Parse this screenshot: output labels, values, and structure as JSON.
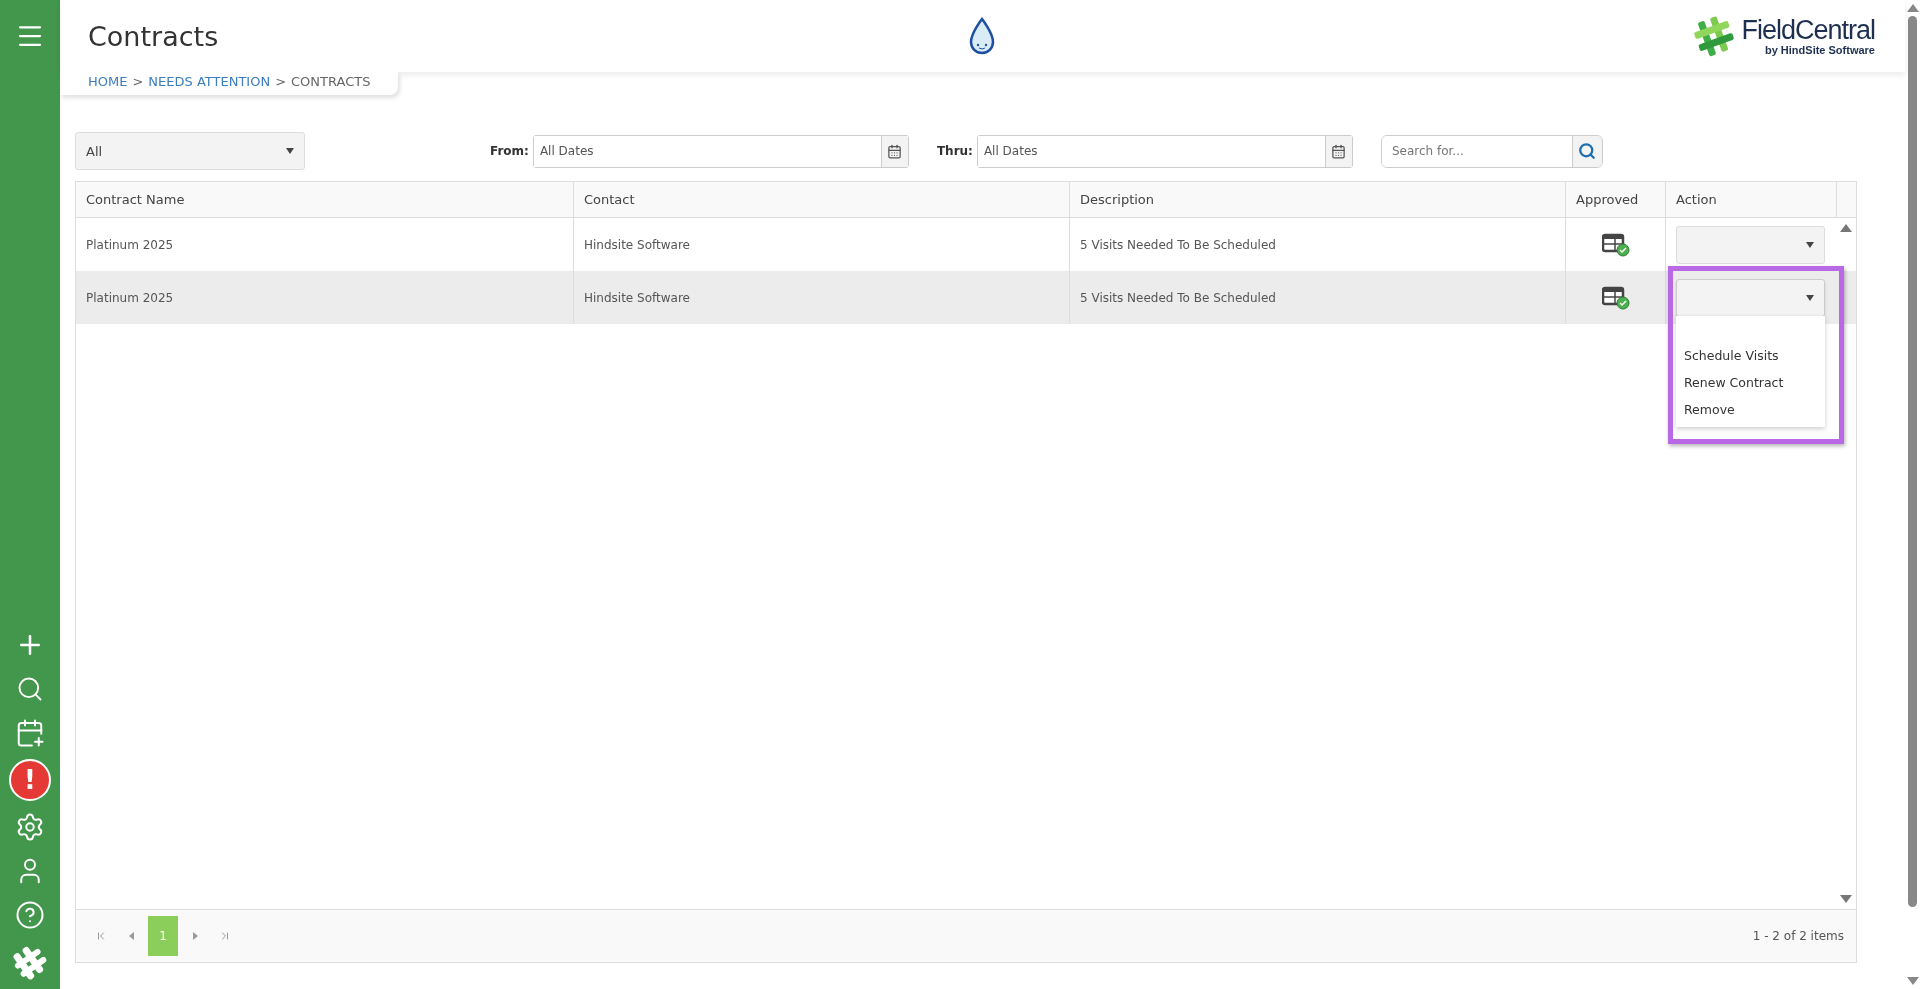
{
  "page": {
    "title": "Contracts"
  },
  "breadcrumb": [
    {
      "label": "HOME",
      "link": true
    },
    {
      "label": ">",
      "link": false
    },
    {
      "label": "NEEDS ATTENTION",
      "link": true
    },
    {
      "label": ">",
      "link": false
    },
    {
      "label": "CONTRACTS",
      "link": false
    }
  ],
  "brand": {
    "name": "FieldCentral",
    "tagline": "by HindSite Software"
  },
  "sidebar": {
    "items": [
      {
        "kind": "add",
        "alert": false
      },
      {
        "kind": "search",
        "alert": false
      },
      {
        "kind": "schedule",
        "alert": false
      },
      {
        "kind": "alert",
        "alert": true,
        "glyph": "!"
      },
      {
        "kind": "settings",
        "alert": false
      },
      {
        "kind": "user",
        "alert": false
      },
      {
        "kind": "help",
        "alert": false
      }
    ]
  },
  "filters": {
    "status": {
      "value": "All"
    },
    "from": {
      "label": "From:",
      "value": "All Dates"
    },
    "thru": {
      "label": "Thru:",
      "value": "All Dates"
    },
    "search": {
      "placeholder": "Search for..."
    }
  },
  "table": {
    "columns": [
      "Contract Name",
      "Contact",
      "Description",
      "Approved",
      "Action"
    ],
    "rows": [
      {
        "contract_name": "Platinum 2025",
        "contact": "Hindsite Software",
        "description": "5 Visits Needed To Be Scheduled",
        "approved": true,
        "selected": false,
        "menu_open": false
      },
      {
        "contract_name": "Platinum 2025",
        "contact": "Hindsite Software",
        "description": "5 Visits Needed To Be Scheduled",
        "approved": true,
        "selected": true,
        "menu_open": true
      }
    ],
    "action_menu": [
      "Schedule Visits",
      "Renew Contract",
      "Remove"
    ]
  },
  "pager": {
    "pages": [
      {
        "label": "1",
        "selected": true
      }
    ],
    "summary": "1 - 2 of 2 items"
  }
}
